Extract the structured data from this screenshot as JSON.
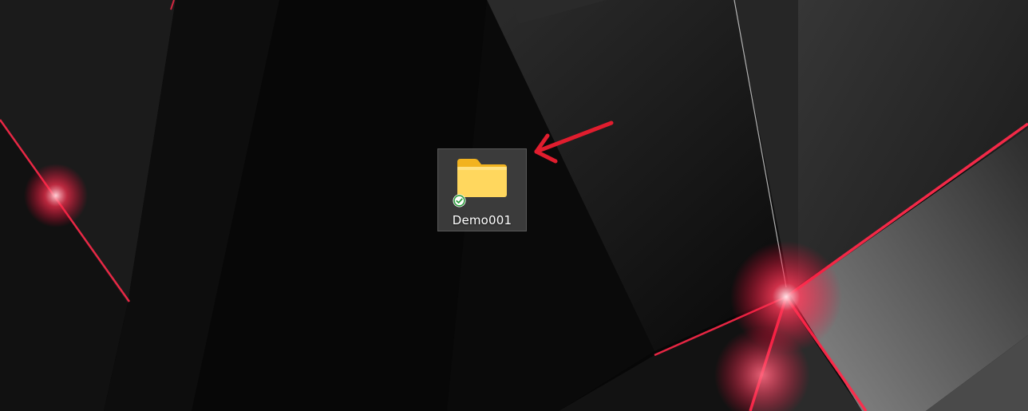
{
  "desktop": {
    "icons": [
      {
        "label": "Demo001",
        "icon": "folder-icon",
        "status_icon": "sync-check-icon",
        "selected": true
      }
    ]
  },
  "annotation": {
    "icon": "red-arrow-icon",
    "color": "#e11d2e"
  },
  "colors": {
    "folder_body": "#ffd75e",
    "folder_tab": "#f2b31f",
    "badge_fill": "#ffffff",
    "badge_check": "#2e9d3f",
    "wallpaper_accent": "#ff2a4a"
  }
}
